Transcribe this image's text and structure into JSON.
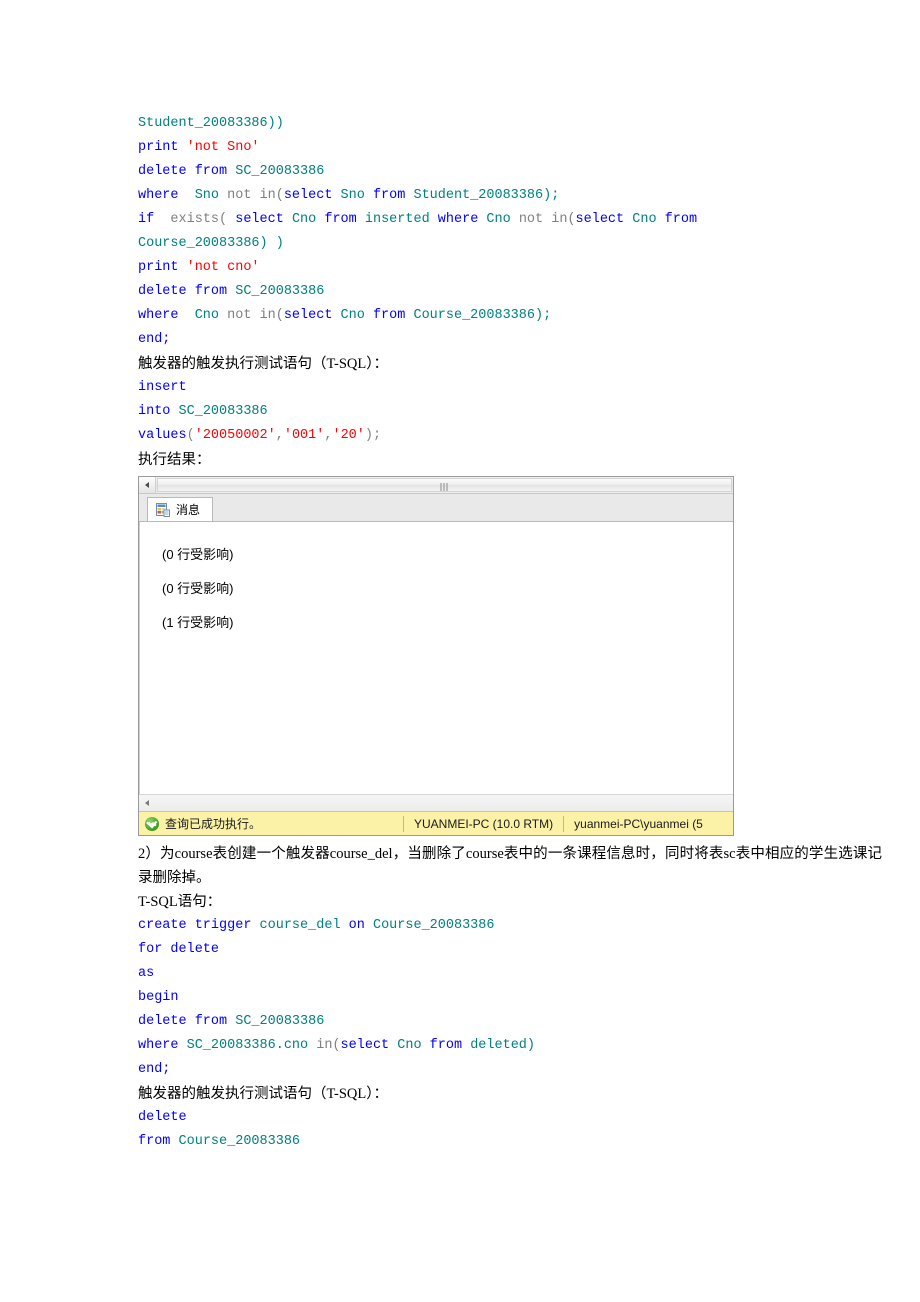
{
  "document": {
    "code_block_1": [
      {
        "tokens": [
          {
            "t": "Student_20083386))",
            "c": "id"
          }
        ]
      },
      {
        "tokens": [
          {
            "t": "print ",
            "c": "k"
          },
          {
            "t": "'not Sno'",
            "c": "s"
          }
        ]
      },
      {
        "tokens": [
          {
            "t": "delete from ",
            "c": "k"
          },
          {
            "t": "SC_20083386",
            "c": "id"
          }
        ]
      },
      {
        "tokens": [
          {
            "t": "where ",
            "c": "k"
          },
          {
            "t": " Sno",
            "c": "id"
          },
          {
            "t": " not in(",
            "c": "op"
          },
          {
            "t": "select ",
            "c": "k"
          },
          {
            "t": "Sno ",
            "c": "id"
          },
          {
            "t": "from ",
            "c": "k"
          },
          {
            "t": "Student_20083386);",
            "c": "id"
          }
        ]
      },
      {
        "tokens": [
          {
            "t": "if ",
            "c": "k"
          },
          {
            "t": " exists( ",
            "c": "op"
          },
          {
            "t": "select ",
            "c": "k"
          },
          {
            "t": "Cno ",
            "c": "id"
          },
          {
            "t": "from ",
            "c": "k"
          },
          {
            "t": "inserted ",
            "c": "id"
          },
          {
            "t": "where ",
            "c": "k"
          },
          {
            "t": "Cno ",
            "c": "id"
          },
          {
            "t": "not in(",
            "c": "op"
          },
          {
            "t": "select ",
            "c": "k"
          },
          {
            "t": "Cno ",
            "c": "id"
          },
          {
            "t": "from",
            "c": "k"
          }
        ]
      },
      {
        "tokens": [
          {
            "t": "Course_20083386) )",
            "c": "id"
          }
        ]
      },
      {
        "tokens": [
          {
            "t": "print ",
            "c": "k"
          },
          {
            "t": "'not cno'",
            "c": "s"
          }
        ]
      },
      {
        "tokens": [
          {
            "t": "delete from ",
            "c": "k"
          },
          {
            "t": "SC_20083386",
            "c": "id"
          }
        ]
      },
      {
        "tokens": [
          {
            "t": "where ",
            "c": "k"
          },
          {
            "t": " Cno",
            "c": "id"
          },
          {
            "t": " not in(",
            "c": "op"
          },
          {
            "t": "select ",
            "c": "k"
          },
          {
            "t": "Cno ",
            "c": "id"
          },
          {
            "t": "from ",
            "c": "k"
          },
          {
            "t": "Course_20083386);",
            "c": "id"
          }
        ]
      },
      {
        "tokens": [
          {
            "t": "end;",
            "c": "k"
          }
        ]
      }
    ],
    "label_test_stmt_1": "触发器的触发执行测试语句（T-SQL）：",
    "code_block_2": [
      {
        "tokens": [
          {
            "t": "insert",
            "c": "k"
          }
        ]
      },
      {
        "tokens": [
          {
            "t": "into ",
            "c": "k"
          },
          {
            "t": "SC_20083386",
            "c": "id"
          }
        ]
      },
      {
        "tokens": [
          {
            "t": "values",
            "c": "k"
          },
          {
            "t": "(",
            "c": "op"
          },
          {
            "t": "'20050002'",
            "c": "s"
          },
          {
            "t": ",",
            "c": "op"
          },
          {
            "t": "'001'",
            "c": "s"
          },
          {
            "t": ",",
            "c": "op"
          },
          {
            "t": "'20'",
            "c": "s"
          },
          {
            "t": ");",
            "c": "op"
          }
        ]
      }
    ],
    "label_result": "执行结果：",
    "paragraph_2": "2）为course表创建一个触发器course_del，当删除了course表中的一条课程信息时，同时将表sc表中相应的学生选课记录删除掉。",
    "label_tsql": "T-SQL语句：",
    "code_block_3": [
      {
        "tokens": [
          {
            "t": "create trigger ",
            "c": "k"
          },
          {
            "t": "course_del ",
            "c": "id"
          },
          {
            "t": "on ",
            "c": "k"
          },
          {
            "t": "Course_20083386",
            "c": "id"
          }
        ]
      },
      {
        "tokens": [
          {
            "t": "for delete",
            "c": "k"
          }
        ]
      },
      {
        "tokens": [
          {
            "t": "as",
            "c": "k"
          }
        ]
      },
      {
        "tokens": [
          {
            "t": "begin",
            "c": "k"
          }
        ]
      },
      {
        "tokens": [
          {
            "t": "delete from ",
            "c": "k"
          },
          {
            "t": "SC_20083386",
            "c": "id"
          }
        ]
      },
      {
        "tokens": [
          {
            "t": "where ",
            "c": "k"
          },
          {
            "t": "SC_20083386.cno ",
            "c": "id"
          },
          {
            "t": "in(",
            "c": "op"
          },
          {
            "t": "select ",
            "c": "k"
          },
          {
            "t": "Cno ",
            "c": "id"
          },
          {
            "t": "from ",
            "c": "k"
          },
          {
            "t": "deleted)",
            "c": "id"
          }
        ]
      },
      {
        "tokens": [
          {
            "t": "end;",
            "c": "k"
          }
        ]
      }
    ],
    "label_test_stmt_2": "触发器的触发执行测试语句（T-SQL）：",
    "code_block_4": [
      {
        "tokens": [
          {
            "t": "delete",
            "c": "k"
          }
        ]
      },
      {
        "tokens": [
          {
            "t": "from ",
            "c": "k"
          },
          {
            "t": "Course_20083386",
            "c": "id"
          }
        ]
      }
    ]
  },
  "ssms": {
    "tab": {
      "label": "消息",
      "icon": "messages-grid-icon"
    },
    "messages": [
      "(0 行受影响)",
      "(0 行受影响)",
      "(1 行受影响)"
    ],
    "status": {
      "result_text": "查询已成功执行。",
      "server": "YUANMEI-PC (10.0 RTM)",
      "user": "yuanmei-PC\\yuanmei (5"
    }
  },
  "colors": {
    "keyword": "#0000ff",
    "identifier": "#008080",
    "string": "#ff0000",
    "operator": "#808080",
    "status_bar_bg": "#fbf2a8",
    "success_green": "#47a526"
  }
}
